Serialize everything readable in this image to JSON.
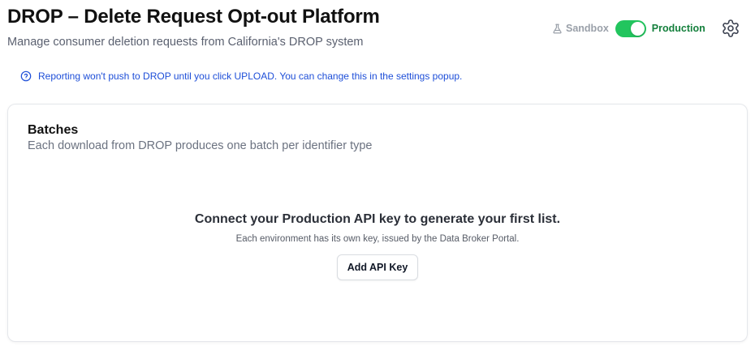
{
  "header": {
    "title": "DROP – Delete Request Opt-out Platform",
    "subtitle": "Manage consumer deletion requests from California's DROP system"
  },
  "environment": {
    "sandbox_label": "Sandbox",
    "production_label": "Production",
    "active": "Production",
    "accent_color": "#22c55e",
    "sandbox_icon": "flask-icon",
    "settings_icon": "gear-icon"
  },
  "notice": {
    "icon": "info-icon",
    "text": "Reporting won't push to DROP until you click UPLOAD. You can change this in the settings popup.",
    "color": "#1d4ed8"
  },
  "batches": {
    "title": "Batches",
    "subtitle": "Each download from DROP produces one batch per identifier type",
    "empty_state": {
      "heading": "Connect your Production API key to generate your first list.",
      "hint": "Each environment has its own key, issued by the Data Broker Portal.",
      "button_label": "Add API Key"
    }
  }
}
